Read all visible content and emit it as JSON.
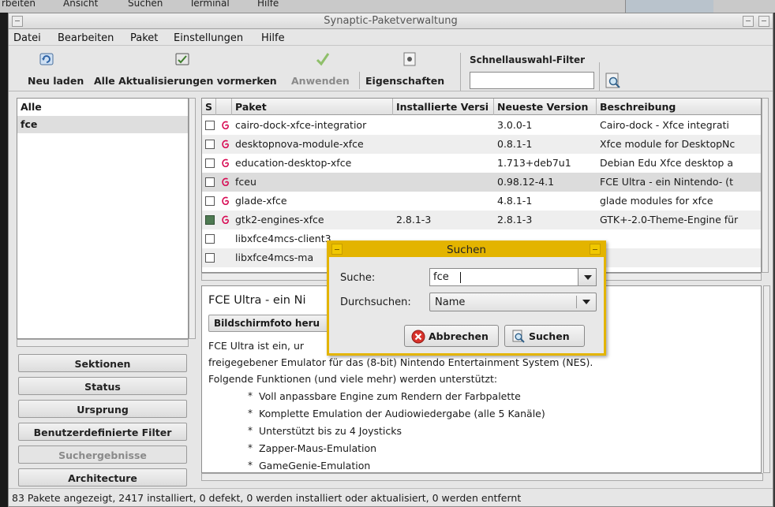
{
  "background": {
    "menu_items": [
      "rbeiten",
      "Ansicht",
      "Suchen",
      "Terminal",
      "Hilfe"
    ]
  },
  "window": {
    "title": "Synaptic-Paketverwaltung"
  },
  "menubar": {
    "file": "Datei",
    "edit": "Bearbeiten",
    "package": "Paket",
    "settings": "Einstellungen",
    "help": "Hilfe"
  },
  "toolbar": {
    "reload": "Neu laden",
    "mark_all_upgrades": "Alle Aktualisierungen vormerken",
    "apply": "Anwenden",
    "properties": "Eigenschaften",
    "quick_filter_label": "Schnellauswahl-Filter",
    "quick_filter_value": ""
  },
  "filter_list": {
    "items": [
      "Alle",
      "fce"
    ],
    "selected": "fce"
  },
  "side_buttons": {
    "sections": "Sektionen",
    "status": "Status",
    "origin": "Ursprung",
    "custom_filters": "Benutzerdefinierte Filter",
    "search_results": "Suchergebnisse",
    "architecture": "Architecture"
  },
  "table": {
    "columns": [
      "S",
      "",
      "Paket",
      "Installierte Versi",
      "Neueste Version",
      "Beschreibung"
    ],
    "rows": [
      {
        "name": "cairo-dock-xfce-integratior",
        "installed": "",
        "latest": "3.0.0-1",
        "description": "Cairo-dock - Xfce integrati",
        "checked": false,
        "debian": true
      },
      {
        "name": "desktopnova-module-xfce",
        "installed": "",
        "latest": "0.8.1-1",
        "description": "Xfce module for DesktopNc",
        "checked": false,
        "debian": true
      },
      {
        "name": "education-desktop-xfce",
        "installed": "",
        "latest": "1.713+deb7u1",
        "description": "Debian Edu Xfce desktop a",
        "checked": false,
        "debian": true
      },
      {
        "name": "fceu",
        "installed": "",
        "latest": "0.98.12-4.1",
        "description": "FCE Ultra - ein Nintendo- (t",
        "checked": false,
        "debian": true
      },
      {
        "name": "glade-xfce",
        "installed": "",
        "latest": "4.8.1-1",
        "description": "glade modules for xfce",
        "checked": false,
        "debian": true
      },
      {
        "name": "gtk2-engines-xfce",
        "installed": "2.8.1-3",
        "latest": "2.8.1-3",
        "description": "GTK+-2.0-Theme-Engine für",
        "checked": true,
        "debian": true
      },
      {
        "name": "libxfce4mcs-client3",
        "installed": "",
        "latest": "",
        "description": "",
        "checked": false,
        "debian": false
      },
      {
        "name": "libxfce4mcs-ma",
        "installed": "",
        "latest": "",
        "description": "",
        "checked": false,
        "debian": false
      }
    ]
  },
  "description": {
    "title": "FCE Ultra -  ein Ni",
    "screenshot_button": "Bildschirmfoto heru",
    "line1": "FCE Ultra ist ein, ur",
    "line2": "freigegebener Emulator für das (8-bit) Nintendo Entertainment System (NES).",
    "line3": "Folgende Funktionen (und viele mehr) werden unterstützt:",
    "bullets": [
      "Voll anpassbare Engine zum Rendern der Farbpalette",
      "Komplette Emulation der Audiowiedergabe (alle 5 Kanäle)",
      "Unterstützt bis zu 4 Joysticks",
      "Zapper-Maus-Emulation",
      "GameGenie-Emulation"
    ]
  },
  "statusbar": "83 Pakete angezeigt, 2417 installiert, 0 defekt, 0 werden installiert oder aktualisiert, 0 werden entfernt",
  "dialog": {
    "title": "Suchen",
    "search_label": "Suche:",
    "search_value": "fce",
    "scope_label": "Durchsuchen:",
    "scope_value": "Name",
    "cancel": "Abbrechen",
    "search": "Suchen"
  },
  "colors": {
    "dialog_accent": "#e3b400",
    "installed_checkbox": "#4e7a52",
    "debian_swirl": "#d70a53"
  }
}
